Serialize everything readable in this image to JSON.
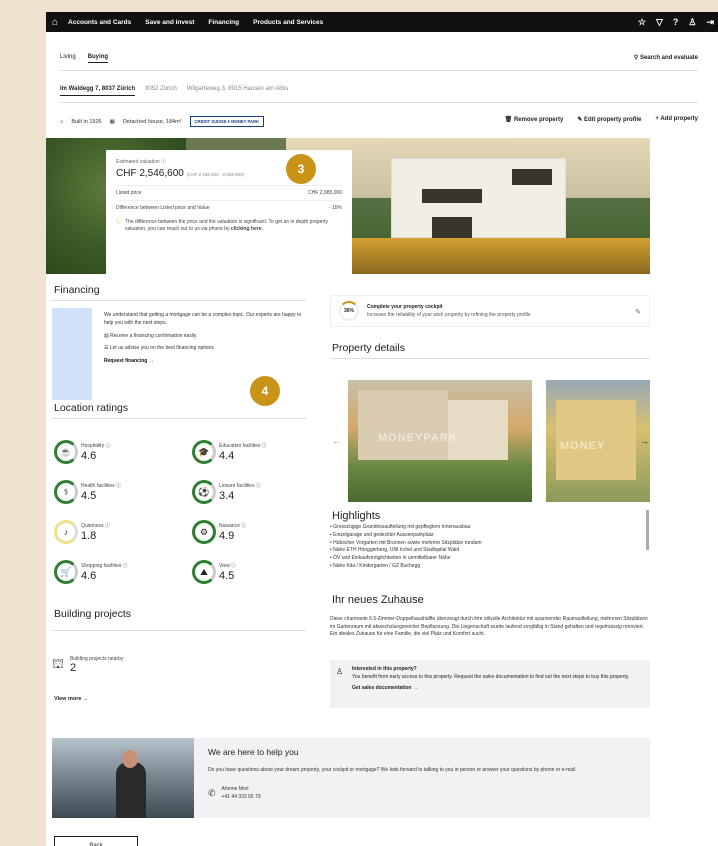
{
  "topnav": {
    "items": [
      "Accounts and Cards",
      "Save and invest",
      "Financing",
      "Products and Services"
    ]
  },
  "subtabs": [
    "Living",
    "Buying"
  ],
  "search_evaluate": "Search and evaluate",
  "address_tabs": [
    "Im Waldegg 7, 8037 Zürich",
    "8052 Zürich",
    "Wilgarteweg 3, 8915 Hausen am Albis"
  ],
  "meta": {
    "built": "Built in 1926",
    "type": "Detached house, 184m²",
    "badge_left": "CREDIT SUISSE",
    "badge_right": "MONEY PARK"
  },
  "actions": {
    "remove": "Remove property",
    "edit": "Edit property profile",
    "add": "Add property"
  },
  "valuation": {
    "label": "Estimated valuation",
    "value": "CHF 2,546,600",
    "range": "(CHF 2,156,200 - 2,926,900)",
    "listed_label": "Listed price",
    "listed_value": "CHF 2,985,000",
    "diff_label": "Difference between Listed price and Value",
    "diff_value": "- 15%",
    "note": "The difference between the price and the valuation is significant. To get an in depth property valuation, you can reach out to us via phone by",
    "note_link": "clicking here."
  },
  "markers": {
    "m3": "3",
    "m4": "4"
  },
  "financing": {
    "title": "Financing",
    "intro": "We understand that getting a mortgage can be a complex topic. Our experts are happy to help you with the next steps.",
    "point1": "Receive a financing confirmation easily",
    "point2": "Let us advise you on the best financing options",
    "request": "Request financing →"
  },
  "location": {
    "title": "Location ratings",
    "items": [
      {
        "name": "Hospitality",
        "value": "4.6",
        "icon": "☕"
      },
      {
        "name": "Education facilities",
        "value": "4.4",
        "icon": "🎓"
      },
      {
        "name": "Health facilities",
        "value": "4.5",
        "icon": "⚕"
      },
      {
        "name": "Leisure facilities",
        "value": "3.4",
        "icon": "⚽"
      },
      {
        "name": "Quietness",
        "value": "1.8",
        "icon": "♪"
      },
      {
        "name": "Nuisance",
        "value": "4.9",
        "icon": "⚙"
      },
      {
        "name": "Shopping facilities",
        "value": "4.6",
        "icon": "🛒"
      },
      {
        "name": "View",
        "value": "4.5",
        "icon": "⛰"
      }
    ]
  },
  "building": {
    "title": "Building projects",
    "nearby_label": "Building projects nearby",
    "nearby_value": "2",
    "view_more": "View more →"
  },
  "cockpit": {
    "percent": "36%",
    "title": "Complete your property cockpit",
    "subtitle": "Increase the reliability of your wish property by refining the property profile"
  },
  "property_details": {
    "title": "Property details",
    "watermark": "MONEYPARK",
    "watermark2": "MONEY"
  },
  "highlights": {
    "title": "Highlights",
    "items": [
      "Grosszügige Grundrissaufteilung mit gepflegtem Innenausbau",
      "Einzelgarage und gedeckter Aussenparkplatz",
      "Hübscher Vorgarten mit Brunnen sowie mehrere Sitzplätze rundum",
      "Nahe ETH Hönggerberg, UNI Irchel und Stadtspital Waid",
      "ÖV und Einkaufsmöglichkeiten in unmittelbarer Nähe",
      "Nahe Kita / Kindergarten / GZ Buchegg"
    ]
  },
  "zuhause": {
    "title": "Ihr neues Zuhause",
    "text": "Diese charmante 6.5-Zimmer-Doppelhaushälfte überzeugt durch ihre stilvolle Architektur mit spannender Raumaufteilung, mehreren Sitzplätzen im Gartenraum mit abwechslungsreicher Bepflanzung. Die Liegenschaft wurde laufend sorgfältig in Stand gehalten und regelmässig renoviert. Ein ideales Zuhause für eine Familie, die viel Platz und Komfort sucht."
  },
  "interest": {
    "title": "Interested in this property?",
    "text": "You benefit from early access to this property. Request the sales documentation to find out the next steps to buy this property.",
    "link": "Get sales documentation →"
  },
  "help": {
    "title": "We are here to help you",
    "text": "Do you have questions about your dream property, your cockpit or mortgage? We look forward to talking to you in person or answer your questions by phone or e-mail.",
    "name": "Aheme Mori",
    "phone": "+41 44 333 65 79"
  },
  "back": "Back"
}
